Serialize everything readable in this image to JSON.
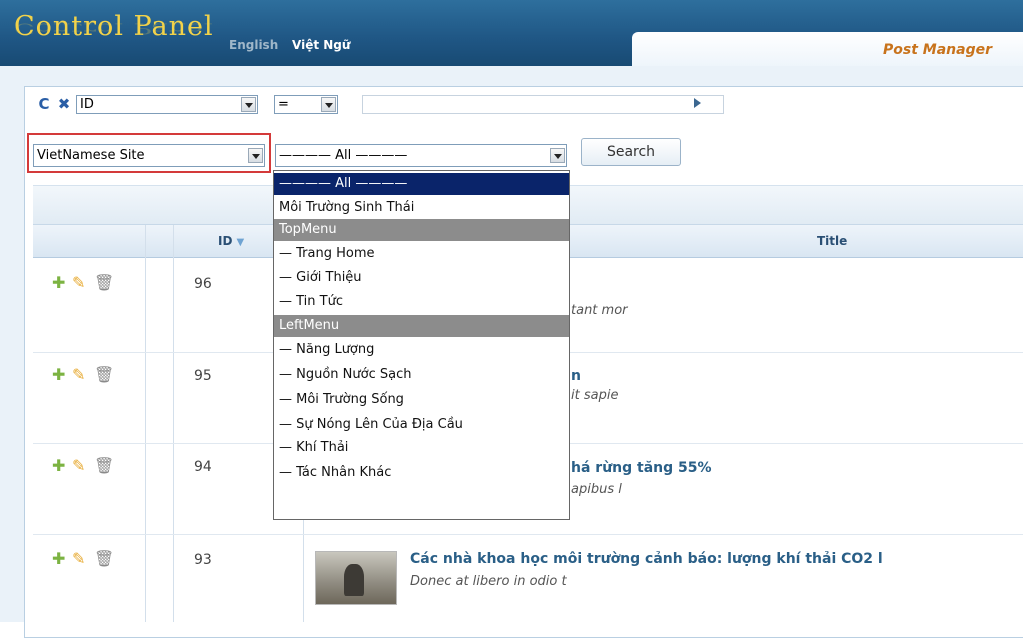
{
  "header": {
    "logo": "Control Panel",
    "lang_en": "English",
    "lang_vi": "Việt Ngữ",
    "active_tab": "Post Manager"
  },
  "toolbar": {
    "refresh_icon": "refresh-icon",
    "cancel_icon": "close-icon",
    "field_select": "ID",
    "operator_select": "=",
    "filter_value": "",
    "site_select": "VietNamese Site",
    "category_select": "———— All ————",
    "search_label": "Search"
  },
  "grid": {
    "col_id": "ID",
    "col_title": "Title",
    "rows": [
      {
        "id": "96",
        "title": "",
        "desc": "tant mor"
      },
      {
        "id": "95",
        "title": "n",
        "desc": "it sapie"
      },
      {
        "id": "94",
        "title": "há rừng tăng 55%",
        "desc": "apibus l"
      },
      {
        "id": "93",
        "title": "Các nhà khoa học môi trường cảnh báo: lượng khí thải CO2 l",
        "desc": "Donec at libero in odio t"
      }
    ]
  },
  "dropdown": {
    "items": [
      {
        "label": "———— All ————",
        "kind": "selected"
      },
      {
        "label": "Môi Trường Sinh Thái",
        "kind": "option"
      },
      {
        "label": "TopMenu",
        "kind": "group"
      },
      {
        "label": "— Trang Home",
        "kind": "option"
      },
      {
        "label": "— Giới Thiệu",
        "kind": "option"
      },
      {
        "label": "— Tin Tức",
        "kind": "option"
      },
      {
        "label": "LeftMenu",
        "kind": "group"
      },
      {
        "label": "— Năng Lượng",
        "kind": "option"
      },
      {
        "label": "— Nguồn Nước Sạch",
        "kind": "option"
      },
      {
        "label": "— Môi Trường Sống",
        "kind": "option"
      },
      {
        "label": "— Sự Nóng Lên Của Địa Cầu",
        "kind": "option"
      },
      {
        "label": "— Khí Thải",
        "kind": "option"
      },
      {
        "label": "— Tác Nhân Khác",
        "kind": "option"
      }
    ]
  },
  "colors": {
    "header_blue": "#1f5684",
    "logo_gold": "#f2d24a",
    "tab_orange": "#c8731c",
    "highlight_red": "#d43a3a",
    "selected_navy": "#0a246a",
    "group_gray": "#8c8c8c",
    "title_blue": "#2a5f87"
  }
}
